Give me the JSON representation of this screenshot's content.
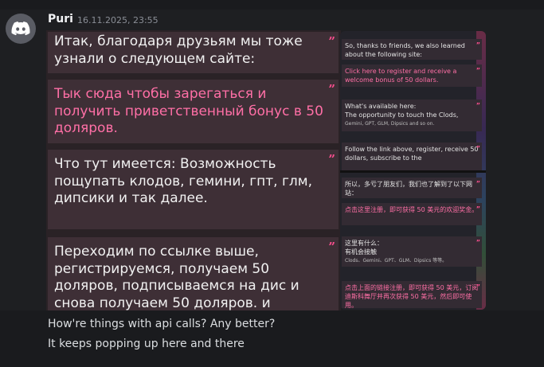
{
  "message": {
    "author": "Puri",
    "timestamp": "16.11.2025, 23:55",
    "avatar_icon": "discord-logo-icon",
    "lines": [
      "How're things with api calls? Any better?",
      "It keeps popping up here and there"
    ]
  },
  "screenshot_ru": {
    "bubbles": [
      {
        "text": "Итак, благодаря друзьям мы тоже узнали о следующем сайте:",
        "color": "#f1f1f1"
      },
      {
        "text": "Тык сюда чтобы зарегаться и получить приветственный бонус в 50 доляров.",
        "color": "#ff6fa6"
      },
      {
        "text": "Что тут имеется: Возможность пощупать клодов, гемини, гпт, глм, дипсики и так далее.",
        "color": "#f1f1f1"
      },
      {
        "text": "Переходим по ссылке выше, регистрируемся, получаем 50 доляров, подписываемся на дис и снова получаем 50 доляров. и",
        "color": "#f1f1f1"
      }
    ]
  },
  "screenshot_en": {
    "b1": "So, thanks to friends, we also learned about the following site:",
    "b2": "Click here to register and receive a welcome bonus of 50 dollars.",
    "b3a": "What's available here:",
    "b3b": "The opportunity to touch the Clods,",
    "b3c": "Gemini, GPT, GLM, Dipsics and so on.",
    "b4": "Follow the link above, register, receive 50 dollars, subscribe to the"
  },
  "screenshot_zh": {
    "b1": "所以，多亏了朋友们，我们也了解到了以下网站：",
    "b2": "点击这里注册，即可获得 50 美元的欢迎奖金。",
    "b3a": "这里有什么：",
    "b3b": "有机会接触",
    "b3c": "Clods、Gemini、GPT、GLM、Dipsics 等等。",
    "b4": "点击上面的链接注册，即可获得 50 美元，订阅迪斯科舞厅并再次获得 50 美元，然后即可使用。"
  }
}
